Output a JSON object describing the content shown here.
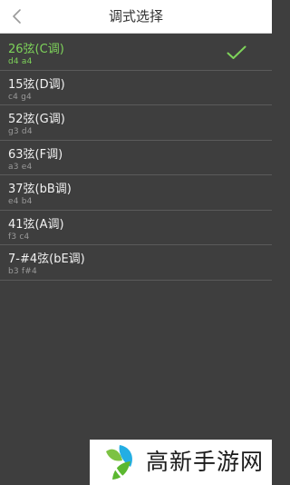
{
  "header": {
    "title": "调式选择",
    "back_icon": "chevron-left-icon"
  },
  "tunings": [
    {
      "name": "26弦(C调)",
      "notes": "d4  a4",
      "selected": true
    },
    {
      "name": "15弦(D调)",
      "notes": "c4  g4",
      "selected": false
    },
    {
      "name": "52弦(G调)",
      "notes": "g3  d4",
      "selected": false
    },
    {
      "name": "63弦(F调)",
      "notes": "a3  e4",
      "selected": false
    },
    {
      "name": "37弦(bB调)",
      "notes": "e4  b4",
      "selected": false
    },
    {
      "name": "41弦(A调)",
      "notes": "f3  c4",
      "selected": false
    },
    {
      "name": "7-#4弦(bE调)",
      "notes": "b3  f#4",
      "selected": false
    }
  ],
  "selected_icon": "checkmark-icon",
  "watermark": {
    "text": "高新手游网",
    "logo_icon": "leaf-logo-icon"
  },
  "colors": {
    "background": "#3e3e3e",
    "header_background": "#ffffff",
    "accent": "#7ed35a",
    "item_text": "#f2f2f2",
    "sub_text": "#9a9a9a",
    "divider": "#5a5a5a"
  }
}
